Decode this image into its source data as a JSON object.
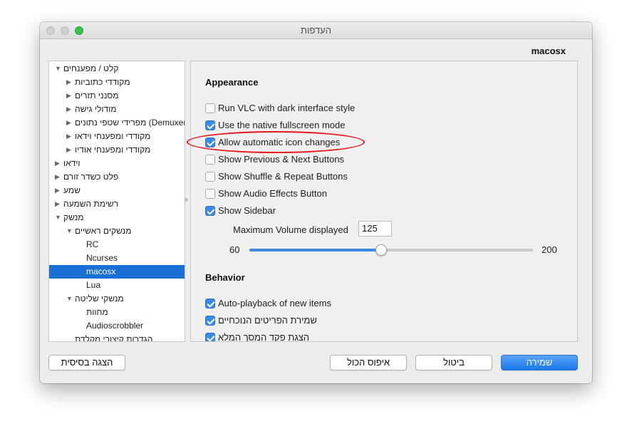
{
  "window": {
    "title": "העדפות"
  },
  "section_label": "macosx",
  "tree": [
    {
      "label": "קלט / מפענחים",
      "indent": 0,
      "arrow": "▼"
    },
    {
      "label": "מקודדי כתוביות",
      "indent": 1,
      "arrow": "▶"
    },
    {
      "label": "מסנני תזרים",
      "indent": 1,
      "arrow": "▶"
    },
    {
      "label": "מודולי גישה",
      "indent": 1,
      "arrow": "▶"
    },
    {
      "label": "מפרידי שטפי נתונים (Demuxers)",
      "indent": 1,
      "arrow": "▶"
    },
    {
      "label": "מקודדי ומפענחי וידאו",
      "indent": 1,
      "arrow": "▶"
    },
    {
      "label": "מקודדי ומפענחי אודיו",
      "indent": 1,
      "arrow": "▶"
    },
    {
      "label": "וידאו",
      "indent": 0,
      "arrow": "▶"
    },
    {
      "label": "פלט כשדר זורם",
      "indent": 0,
      "arrow": "▶"
    },
    {
      "label": "שמע",
      "indent": 0,
      "arrow": "▶"
    },
    {
      "label": "רשימת השמעה",
      "indent": 0,
      "arrow": "▶"
    },
    {
      "label": "מנשק",
      "indent": 0,
      "arrow": "▼"
    },
    {
      "label": "מנשקים ראשיים",
      "indent": 1,
      "arrow": "▼"
    },
    {
      "label": "RC",
      "indent": 2,
      "arrow": ""
    },
    {
      "label": "Ncurses",
      "indent": 2,
      "arrow": ""
    },
    {
      "label": "macosx",
      "indent": 2,
      "arrow": "",
      "selected": true
    },
    {
      "label": "Lua",
      "indent": 2,
      "arrow": ""
    },
    {
      "label": "מנשקי שליטה",
      "indent": 1,
      "arrow": "▼"
    },
    {
      "label": "מחוות",
      "indent": 2,
      "arrow": ""
    },
    {
      "label": "Audioscrobbler",
      "indent": 2,
      "arrow": ""
    },
    {
      "label": "הגדרות קיצורי מקלדת",
      "indent": 1,
      "arrow": ""
    }
  ],
  "appearance": {
    "title": "Appearance",
    "options": [
      {
        "label": "Run VLC with dark interface style",
        "checked": false
      },
      {
        "label": "Use the native fullscreen mode",
        "checked": true
      },
      {
        "label": "Allow automatic icon changes",
        "checked": true
      },
      {
        "label": "Show Previous & Next Buttons",
        "checked": false
      },
      {
        "label": "Show Shuffle & Repeat Buttons",
        "checked": false
      },
      {
        "label": "Show Audio Effects Button",
        "checked": false
      },
      {
        "label": "Show Sidebar",
        "checked": true
      }
    ],
    "max_volume_label": "Maximum Volume displayed",
    "max_volume_value": "125",
    "slider_min": "60",
    "slider_max": "200",
    "slider_value": 125
  },
  "behavior": {
    "title": "Behavior",
    "options": [
      {
        "label": "Auto-playback of new items",
        "checked": true
      },
      {
        "label": "שמירת הפריטים הנוכחיים",
        "checked": true
      },
      {
        "label": "הצגת פקד המסך המלא",
        "checked": true
      }
    ]
  },
  "buttons": {
    "basic": "הצגה בסיסית",
    "reset_all": "איפוס הכול",
    "cancel": "ביטול",
    "save": "שמירה"
  },
  "colors": {
    "accent": "#1a78ec",
    "selection": "#1a6fd6",
    "annotation": "#e8141b"
  }
}
